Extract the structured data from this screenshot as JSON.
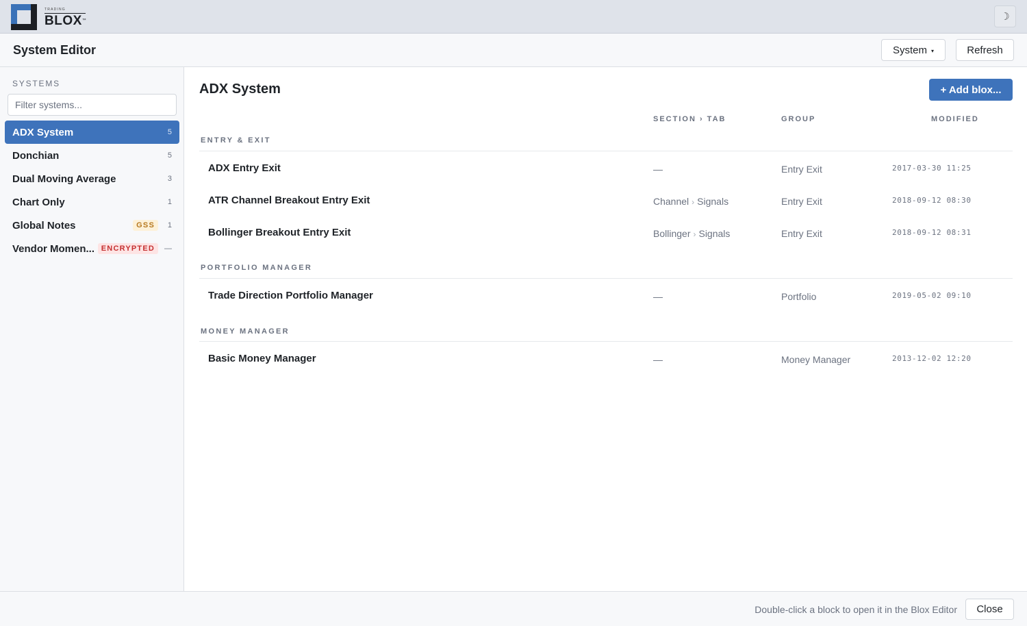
{
  "app": {
    "logo_small": "TRADING",
    "logo_big": "BLOX",
    "logo_tm": "™",
    "theme_toggle_glyph": "☽"
  },
  "window": {
    "title": "System Editor",
    "system_button": "System",
    "system_caret": "▾",
    "refresh_button": "Refresh"
  },
  "sidebar": {
    "heading": "SYSTEMS",
    "filter_placeholder": "Filter systems...",
    "items": [
      {
        "name": "ADX System",
        "count": "5",
        "badge": "",
        "active": true
      },
      {
        "name": "Donchian",
        "count": "5",
        "badge": ""
      },
      {
        "name": "Dual Moving Average",
        "count": "3",
        "badge": ""
      },
      {
        "name": "Chart Only",
        "count": "1",
        "badge": ""
      },
      {
        "name": "Global Notes",
        "count": "1",
        "badge": "GSS"
      },
      {
        "name": "Vendor Momen...",
        "count": "—",
        "badge": "ENCRYPTED"
      }
    ]
  },
  "main": {
    "title": "ADX System",
    "add_button": "+ Add blox...",
    "columns": {
      "section_tab": "SECTION › TAB",
      "group": "GROUP",
      "modified": "MODIFIED"
    },
    "sections": [
      {
        "label": "ENTRY & EXIT",
        "rows": [
          {
            "name": "ADX Entry Exit",
            "section": "—",
            "tab": "",
            "group": "Entry Exit",
            "modified": "2017-03-30 11:25"
          },
          {
            "name": "ATR Channel Breakout Entry Exit",
            "section": "Channel",
            "tab": "Signals",
            "group": "Entry Exit",
            "modified": "2018-09-12 08:30"
          },
          {
            "name": "Bollinger Breakout Entry Exit",
            "section": "Bollinger",
            "tab": "Signals",
            "group": "Entry Exit",
            "modified": "2018-09-12 08:31"
          }
        ]
      },
      {
        "label": "PORTFOLIO MANAGER",
        "rows": [
          {
            "name": "Trade Direction Portfolio Manager",
            "section": "—",
            "tab": "",
            "group": "Portfolio",
            "modified": "2019-05-02 09:10"
          }
        ]
      },
      {
        "label": "MONEY MANAGER",
        "rows": [
          {
            "name": "Basic Money Manager",
            "section": "—",
            "tab": "",
            "group": "Money Manager",
            "modified": "2013-12-02 12:20"
          }
        ]
      }
    ],
    "tab_separator": "›"
  },
  "footer": {
    "hint": "Double-click a block to open it in the Blox Editor",
    "close_button": "Close"
  },
  "colors": {
    "accent": "#3e73bb",
    "gss_badge": "#b7791f",
    "encrypted_badge": "#c53030"
  }
}
